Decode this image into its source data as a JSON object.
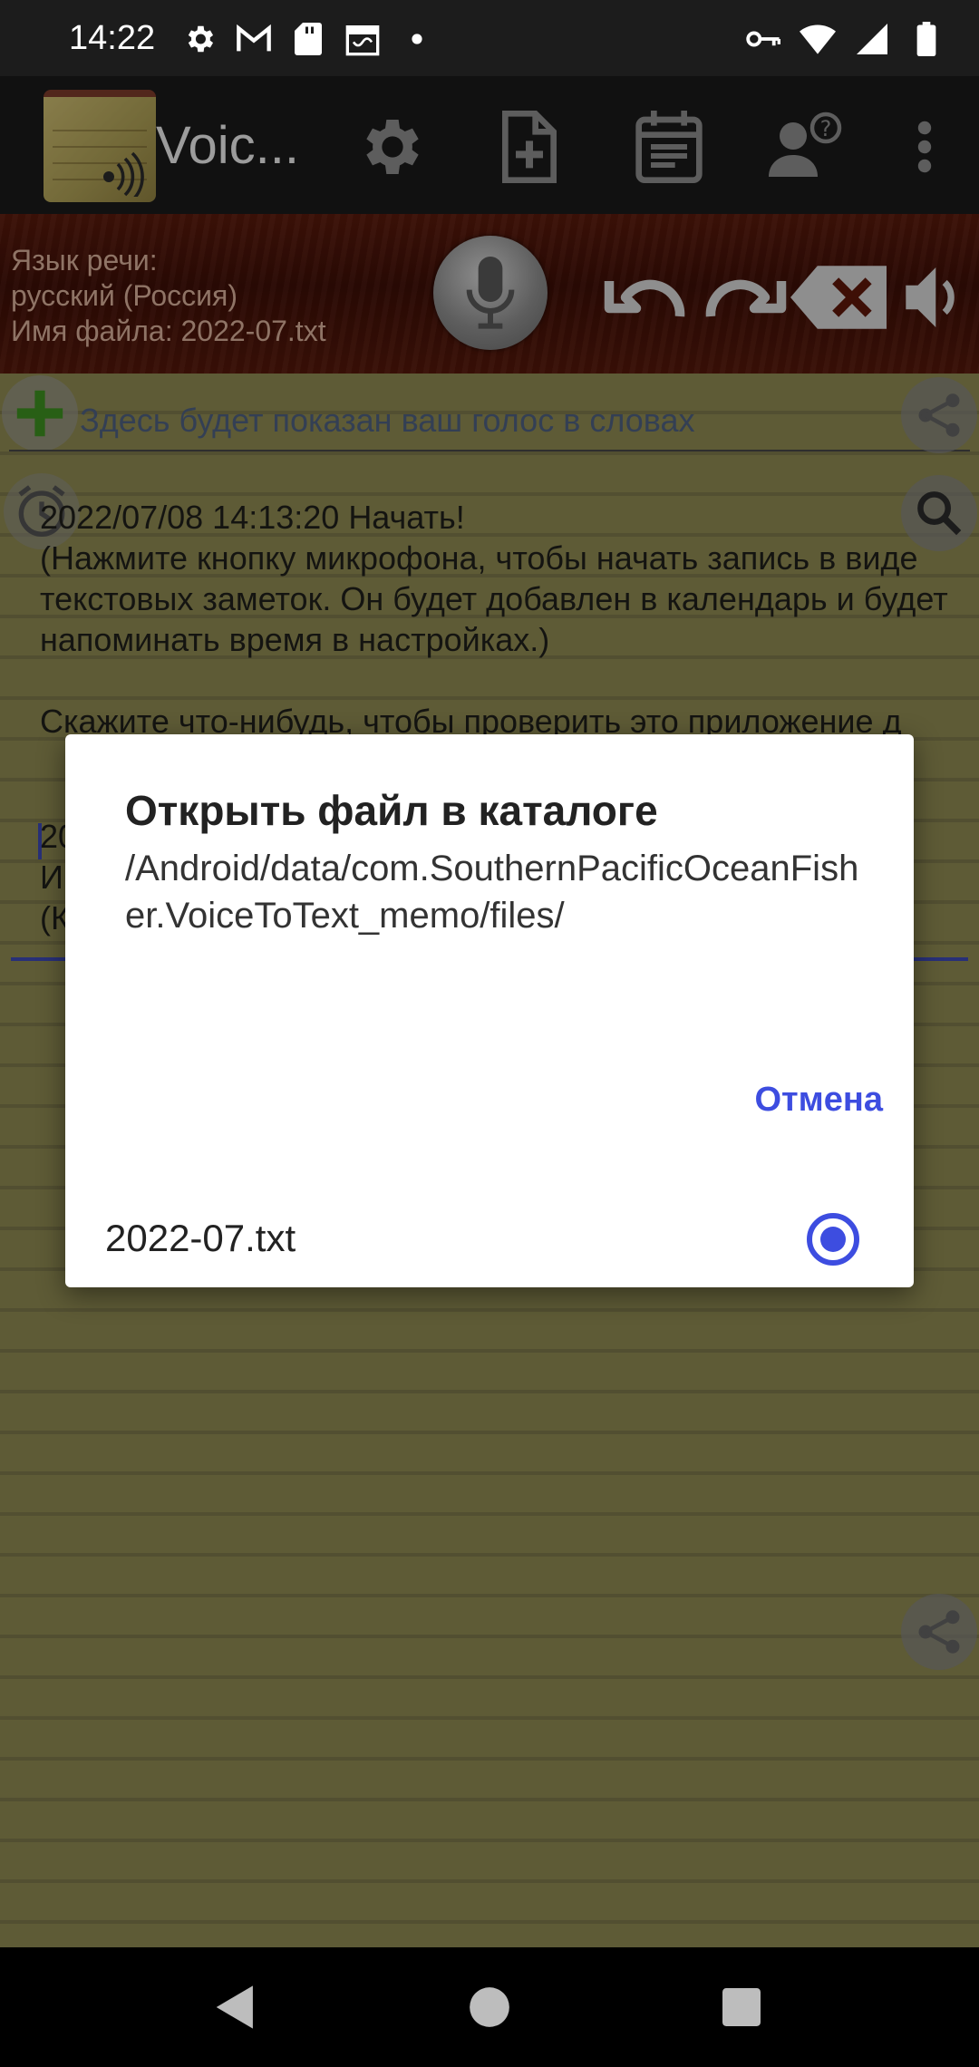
{
  "status_bar": {
    "time": "14:22",
    "left_icons": [
      "settings-icon",
      "gmail-icon",
      "sd-card-icon",
      "calendar-icon",
      "dot-icon"
    ],
    "right_icons": [
      "vpn-key-icon",
      "wifi-icon",
      "signal-icon",
      "battery-icon"
    ]
  },
  "toolbar": {
    "app_title": "Voic...",
    "buttons": [
      "settings-icon",
      "new-file-icon",
      "calendar-list-icon",
      "account-help-icon",
      "more-vert-icon"
    ]
  },
  "control_band": {
    "speech_language_label": "Язык речи:",
    "speech_language_value": "русский (Россия)",
    "file_name_line": "Имя файла: 2022-07.txt"
  },
  "notepad": {
    "hint": "Здесь будет показан ваш голос в словах",
    "entry_text": "2022/07/08 14:13:20 Начать!\n(Нажмите кнопку микрофона, чтобы начать запись в виде текстовых заметок. Он будет добавлен в календарь и будет напоминать время в настройках.)\n\nСкажите что-нибудь, чтобы проверить это приложение д",
    "entry_text_2": "20\nИ\n(К"
  },
  "dialog": {
    "title": "Открыть файл в каталоге",
    "path": "/Android/data/com.SouthernPacificOceanFisher.VoiceToText_memo/files/",
    "cancel_label": "Отмена",
    "files": [
      {
        "name": "2022-07.txt",
        "selected": true
      }
    ]
  },
  "colors": {
    "accent": "#3d4de0",
    "notepad": "#8b8650",
    "toolbar": "#1a1a1a",
    "wood": "#4a1408"
  }
}
